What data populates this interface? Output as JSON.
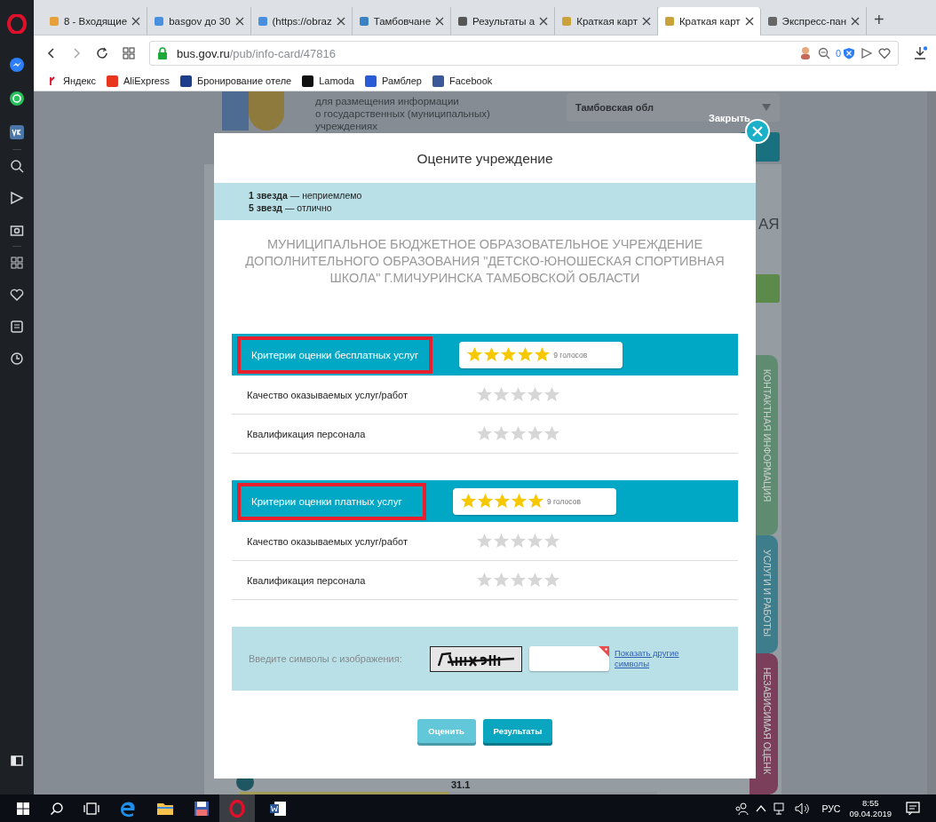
{
  "browser": {
    "tabs": [
      {
        "title": "8 - Входящие",
        "selected": false
      },
      {
        "title": "basgov до 30",
        "selected": false
      },
      {
        "title": "(https://obraz",
        "selected": false
      },
      {
        "title": "Тамбовчане",
        "selected": false
      },
      {
        "title": "Результаты а",
        "selected": false
      },
      {
        "title": "Краткая карт",
        "selected": false
      },
      {
        "title": "Краткая карт",
        "selected": true
      },
      {
        "title": "Экспресс-пан",
        "selected": false
      }
    ],
    "new_tab": "+",
    "address": {
      "host": "bus.gov.ru",
      "path": "/pub/info-card/47816"
    },
    "blocked_count": "0",
    "bookmarks": [
      "Яндекс",
      "AliExpress",
      "Бронирование отеле",
      "Lamoda",
      "Рамблер",
      "Facebook"
    ]
  },
  "background_page": {
    "header_lines": [
      "для размещения информации",
      "о государственных (муниципальных)",
      "учреждениях"
    ],
    "region_select": "Тамбовская обл",
    "heading_fragment": "АЯ",
    "side_tabs": [
      {
        "label": "КОНТАКТНАЯ ИНФОРМАЦИЯ",
        "color": "#5f8c70"
      },
      {
        "label": "УСЛУГИ И РАБОТЫ",
        "color": "#3e7d8c"
      },
      {
        "label": "НЕЗАВИСИМАЯ ОЦЕНК",
        "color": "#7b3f5c"
      }
    ],
    "figure": "31.1",
    "progress": {
      "level": 0.5
    }
  },
  "modal": {
    "close_label": "Закрыть",
    "title": "Оцените учреждение",
    "legend": [
      "**1 звезда** — неприемлемо",
      "**5 звезд** — отлично"
    ],
    "institution": "МУНИЦИПАЛЬНОЕ БЮДЖЕТНОЕ ОБРАЗОВАТЕЛЬНОЕ УЧРЕЖДЕНИЕ ДОПОЛНИТЕЛЬНОГО ОБРАЗОВАНИЯ \"ДЕТСКО-ЮНОШЕСКАЯ СПОРТИВНАЯ ШКОЛА\" Г.МИЧУРИНСКА ТАМБОВСКОЙ ОБЛАСТИ",
    "sections": [
      {
        "title": "Критерии оценки бесплатных услуг",
        "highlighted": true,
        "stars": 5,
        "votes": "9 голосов",
        "criteria": [
          {
            "label": "Качество оказываемых услуг/работ",
            "stars": 0
          },
          {
            "label": "Квалификация персонала",
            "stars": 0
          }
        ]
      },
      {
        "title": "Критерии оценки платных услуг",
        "highlighted": true,
        "stars": 5,
        "votes": "9 голосов",
        "criteria": [
          {
            "label": "Качество оказываемых услуг/работ",
            "stars": 0
          },
          {
            "label": "Квалификация персонала",
            "stars": 0
          }
        ]
      }
    ],
    "captcha": {
      "label": "Введите символы с изображения:",
      "required": true,
      "link": "Показать другие символы"
    },
    "buttons": [
      {
        "label": "Оценить",
        "kind": "secondary"
      },
      {
        "label": "Результаты",
        "kind": "primary"
      }
    ]
  },
  "taskbar": {
    "language": "РУС",
    "time": "8:55",
    "date": "09.04.2019"
  }
}
